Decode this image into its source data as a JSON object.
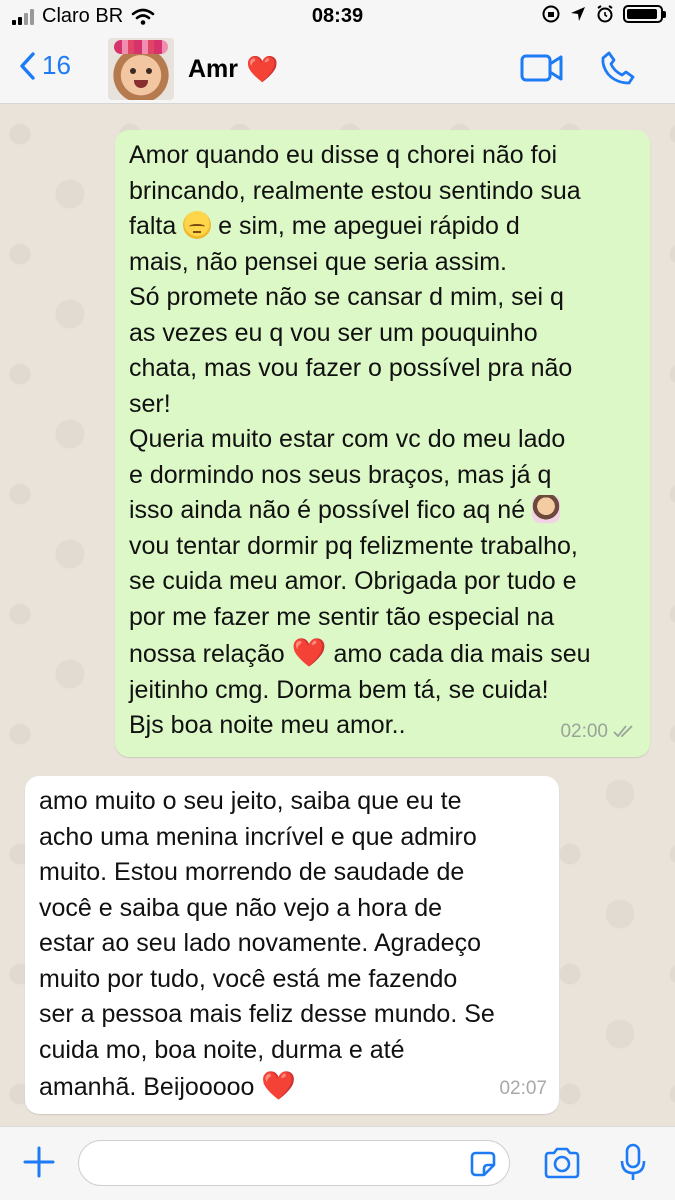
{
  "status_bar": {
    "carrier": "Claro BR",
    "time": "08:39",
    "battery_level": 0.95
  },
  "header": {
    "back_count": "16",
    "contact_name": "Amr",
    "name_emoji": "❤️",
    "icons": [
      "back-chevron-icon",
      "video-call-icon",
      "phone-call-icon"
    ]
  },
  "messages": [
    {
      "direction": "outgoing",
      "lines": [
        "Amor quando eu disse q chorei não foi",
        "brincando, realmente estou sentindo sua",
        "falta",
        "e sim, me apeguei rápido d",
        "mais, não pensei que seria assim.",
        "Só promete não se cansar d mim, sei q",
        "as vezes eu q vou ser um pouquinho",
        "chata, mas vou fazer o possível pra não",
        "ser!",
        "Queria muito estar com vc do meu lado",
        "e dormindo nos seus braços, mas já q",
        "isso ainda não é possível fico aq né",
        "vou tentar dormir pq felizmente trabalho,",
        "se cuida meu amor. Obrigada por tudo e",
        "por me fazer me sentir tão especial na",
        "nossa relação",
        "amo cada dia mais seu",
        "jeitinho cmg. Dorma bem tá, se cuida!",
        "Bjs boa noite meu amor.."
      ],
      "heart": "❤️",
      "time": "02:00",
      "status": "read"
    },
    {
      "direction": "incoming",
      "lines": [
        "amo muito o seu jeito, saiba que eu te",
        "acho uma menina incrível e que admiro",
        "muito. Estou morrendo de saudade de",
        "você e saiba que não vejo a hora de",
        "estar ao seu lado novamente. Agradeço",
        "muito por tudo, você está me fazendo",
        "ser a pessoa mais feliz desse mundo. Se",
        "cuida mo, boa noite, durma e até",
        "amanhã. Beijooooo"
      ],
      "heart": "❤️",
      "time": "02:07"
    }
  ],
  "input_bar": {
    "value": "",
    "icons": [
      "plus-icon",
      "sticker-icon",
      "camera-icon",
      "microphone-icon"
    ]
  },
  "colors": {
    "accent": "#1E7BF6",
    "outgoing_bubble": "#DCF8C6",
    "incoming_bubble": "#FFFFFF",
    "chat_background": "#EAE3D9"
  }
}
